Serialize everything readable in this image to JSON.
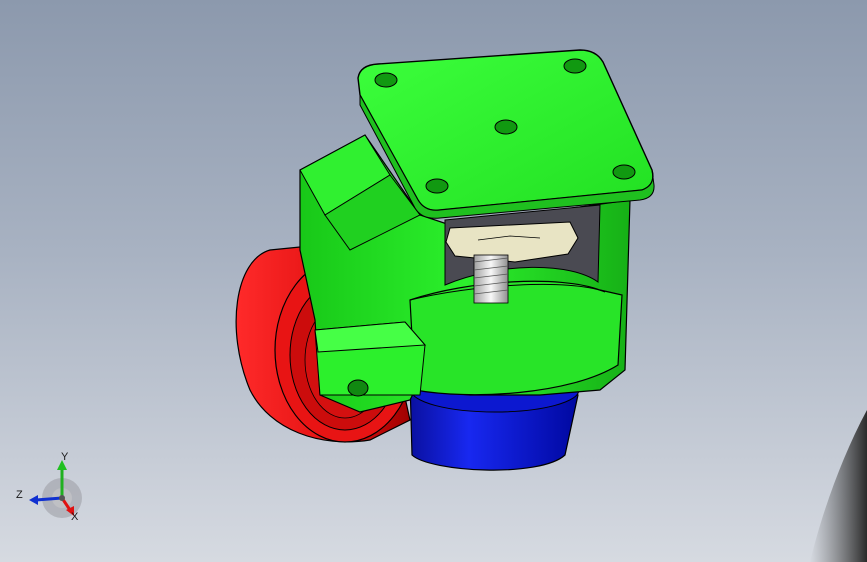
{
  "viewport": {
    "background_top": "#8c99ad",
    "background_bottom": "#d6dae1"
  },
  "model": {
    "parts": [
      {
        "name": "mounting-plate",
        "color": "#2bf52b"
      },
      {
        "name": "wheel",
        "color": "#f01010"
      },
      {
        "name": "leveling-pad",
        "color": "#0a14d8"
      },
      {
        "name": "hex-nut",
        "color": "#e8e4c4"
      },
      {
        "name": "threaded-stem",
        "color": "#d8d8d8"
      }
    ]
  },
  "triad": {
    "x_label": "X",
    "y_label": "Y",
    "z_label": "Z",
    "x_color": "#e01010",
    "y_color": "#20b020",
    "z_color": "#1030d0"
  }
}
